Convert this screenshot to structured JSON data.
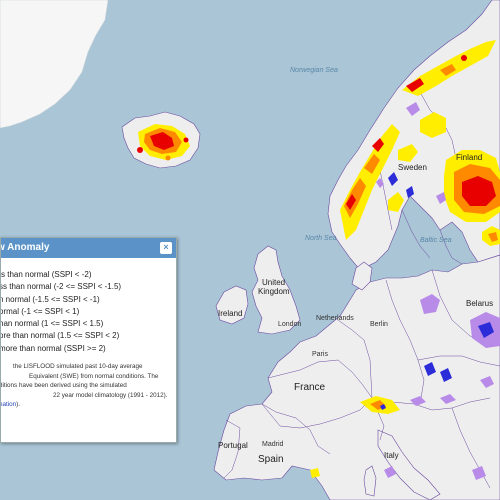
{
  "map": {
    "labels": {
      "norwegian_sea": "Norwegian Sea",
      "north_sea": "North Sea",
      "baltic_sea": "Baltic Sea",
      "united_kingdom_line1": "United",
      "united_kingdom_line2": "Kingdom",
      "ireland": "Ireland",
      "france": "France",
      "spain": "Spain",
      "portugal": "Portugal",
      "netherlands": "Netherlands",
      "london": "London",
      "paris": "Paris",
      "italy": "Italy",
      "sweden": "Sweden",
      "finland": "Finland",
      "belarus": "Belarus",
      "berlin": "Berlin",
      "madrid": "Madrid"
    },
    "colors": {
      "sea": "#a9c5d6",
      "land": "#eeeeee",
      "greenland": "#f6f6f6",
      "border": "#6b4aa0",
      "anomaly_red": "#e80000",
      "anomaly_orange": "#ff8a00",
      "anomaly_yellow": "#ffee00",
      "anomaly_blue": "#2c2cd8",
      "anomaly_purple": "#b98be8"
    }
  },
  "legend": {
    "title": "w Anomaly",
    "close_label": "×",
    "items": [
      "ss than normal (SSPI < -2)",
      "ss than normal (-2 <= SSPI < -1.5)",
      "n normal (-1.5 <= SSPI < -1)",
      "ormal (-1 <= SSPI < 1)",
      "han normal (1 <= SSPI < 1.5)",
      "ore than normal (1.5 <= SSPI < 2)",
      "more than normal (SSPI >= 2)"
    ],
    "description_lines": [
      "the LISFLOOD simulated past 10-day average",
      "Equivalent (SWE) from normal conditions. The",
      "ditions have been derived using the simulated",
      "22 year model climatology (1991 - 2012)."
    ],
    "link_text": "nation",
    "link_suffix": ")."
  }
}
